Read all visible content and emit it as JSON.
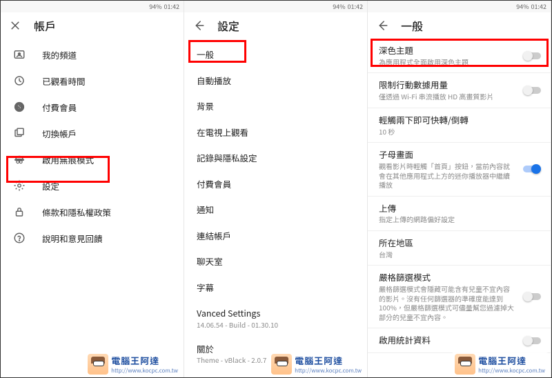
{
  "status": {
    "signal": "⬧",
    "net": "⇅",
    "batt": "94%",
    "time": "01:42"
  },
  "p1": {
    "title": "帳戶",
    "items": [
      {
        "icon": "channel",
        "label": "我的頻道"
      },
      {
        "icon": "history",
        "label": "已觀看時間"
      },
      {
        "icon": "paid",
        "label": "付費會員"
      },
      {
        "icon": "switch",
        "label": "切換帳戶"
      },
      {
        "icon": "incog",
        "label": "啟用無痕模式"
      },
      {
        "icon": "gear",
        "label": "設定"
      },
      {
        "icon": "lock",
        "label": "條款和隱私權政策"
      },
      {
        "icon": "help",
        "label": "說明和意見回饋"
      }
    ]
  },
  "p2": {
    "title": "設定",
    "items": [
      "一般",
      "自動播放",
      "背景",
      "在電視上觀看",
      "記錄與隱私設定",
      "付費會員",
      "通知",
      "連結帳戶",
      "聊天室",
      "字幕"
    ],
    "vanced": {
      "name": "Vanced Settings",
      "sub": "14.06.54 - Build - 01.30.10"
    },
    "about": {
      "name": "關於",
      "sub": "Theme - vBlack - 2.0.7"
    }
  },
  "p3": {
    "title": "一般",
    "opts": [
      {
        "t": "深色主題",
        "s": "為應用程式全面啟用深色主題",
        "on": false
      },
      {
        "t": "限制行動數據用量",
        "s": "僅透過 Wi-Fi 串流播放 HD 高畫質影片",
        "on": false
      },
      {
        "t": "輕觸兩下即可快轉/倒轉",
        "s": "10 秒",
        "on": null
      },
      {
        "t": "子母畫面",
        "s": "觀看影片時輕觸「首頁」按鈕，當前內容就會在其他應用程式上方的迷你播放器中繼續播放",
        "on": true
      },
      {
        "t": "上傳",
        "s": "指定上傳的網路偏好設定",
        "on": null
      },
      {
        "t": "所在地區",
        "s": "台灣",
        "on": null
      },
      {
        "t": "嚴格篩選模式",
        "s": "嚴格篩選模式會隱藏可能含有兒童不宜內容的影片。沒有任何篩選器的準確度能達到 100%，但嚴格篩選模式可儘量幫您過濾掉大部分的兒童不宜內容。",
        "on": false
      },
      {
        "t": "啟用統計資料",
        "s": "",
        "on": false
      }
    ]
  },
  "wm": {
    "t1": "電腦王阿達",
    "t2": "http://www.kocpc.com.tw"
  }
}
